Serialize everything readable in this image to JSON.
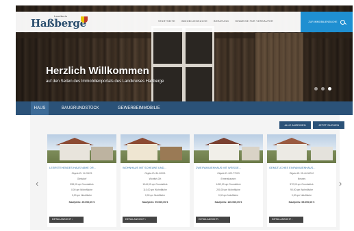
{
  "header": {
    "logo_small": "Landkreis",
    "logo_main": "Haßberge",
    "nav": [
      "STARTSEITE",
      "IMMOBILIENSUCHE",
      "BERATUNG",
      "HINWEISE FÜR VERKÄUFER"
    ],
    "cta_label": "ZUR IMMOBILIENSUCHE"
  },
  "hero": {
    "title": "Herzlich Willkommen",
    "subtitle": "auf den Seiten des Immobilienportals des Landkreises Haßberge"
  },
  "tabs": [
    {
      "label": "HAUS",
      "active": true
    },
    {
      "label": "BAUGRUNDSTÜCK",
      "active": false
    },
    {
      "label": "GEWERBEIMMOBILIE",
      "active": false
    }
  ],
  "actions": {
    "show_all": "ALLE ANZEIGEN",
    "search_now": "JETZT SUCHEN"
  },
  "listings": [
    {
      "title": "LEERSTEHENDES HAUS NÄHE OR...",
      "id": "Objekt-ID: VL21676",
      "place": "Gleisdorf",
      "plot": "598,00 qm Grundstück",
      "living": "0,00 qm Wohnfläche",
      "usable": "0,00 qm Nutzfläche",
      "price": "Kaufpreis: 25.000,00 €",
      "detail": "DETAILANSICHT"
    },
    {
      "title": "WOHNHAUS MIT SCHEUNE UND...",
      "id": "Objekt-ID: 84-00001",
      "place": "Wonfurt-Ort",
      "plot": "1044,00 qm Grundstück",
      "living": "110,00 qm Wohnfläche",
      "usable": "0,00 qm Nutzfläche",
      "price": "Kaufpreis: 99.000,00 €",
      "detail": "DETAILANSICHT"
    },
    {
      "title": "ZWEIFAMILIENHAUS MIT WEISGE...",
      "id": "Objekt-ID: 002-77003",
      "place": "Ermershausen",
      "plot": "1452,00 qm Grundstück",
      "living": "200,00 qm Wohnfläche",
      "usable": "0,00 qm Nutzfläche",
      "price": "Kaufpreis: 120.000,00 €",
      "detail": "DETAILANSICHT"
    },
    {
      "title": "GEMÜTLICHES EINFAMILIENHAUS...",
      "id": "Objekt-ID: 05-44-00010",
      "place": "Neuses",
      "plot": "572,00 qm Grundstück",
      "living": "90,00 qm Wohnfläche",
      "usable": "0,00 qm Nutzfläche",
      "price": "Kaufpreis: 65.000,00 €",
      "detail": "DETAILANSICHT"
    }
  ],
  "icons": {
    "prev": "chevron-left-icon",
    "next": "chevron-right-icon",
    "search": "search-icon"
  },
  "colors": {
    "brand_blue": "#2b5278",
    "cta_blue": "#1f8fd1"
  }
}
